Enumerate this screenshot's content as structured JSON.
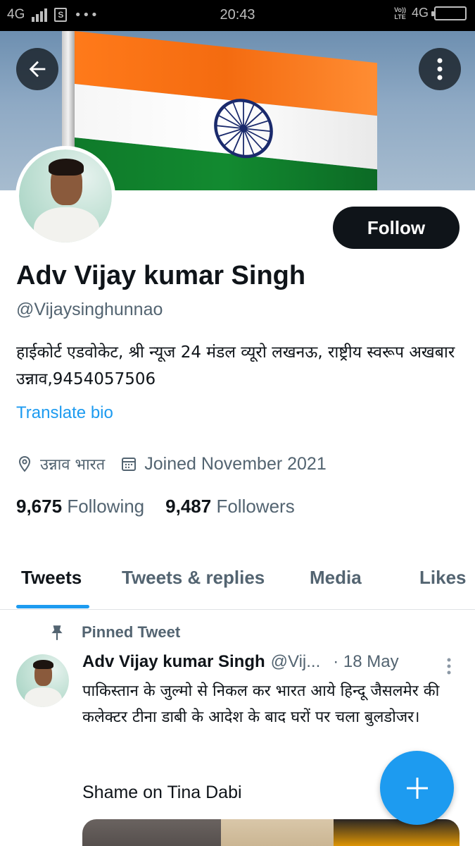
{
  "status_bar": {
    "left_network": "4G",
    "time": "20:43",
    "volte_top": "Vo))",
    "volte_bottom": "LTE",
    "right_network": "4G"
  },
  "profile": {
    "display_name": "Adv Vijay kumar Singh",
    "handle": "@Vijaysinghunnao",
    "bio": "हाईकोर्ट एडवोकेट, श्री न्यूज 24 मंडल व्यूरो लखनऊ, राष्ट्रीय स्वरूप अखबार उन्नाव,9454057506",
    "translate_label": "Translate bio",
    "location": "उन्नाव भारत",
    "joined": "Joined November 2021",
    "following_count": "9,675",
    "following_label": "Following",
    "followers_count": "9,487",
    "followers_label": "Followers",
    "follow_label": "Follow"
  },
  "tabs": [
    {
      "label": "Tweets",
      "active": true
    },
    {
      "label": "Tweets & replies",
      "active": false
    },
    {
      "label": "Media",
      "active": false
    },
    {
      "label": "Likes",
      "active": false
    }
  ],
  "pinned_tweet": {
    "pin_label": "Pinned Tweet",
    "author_name": "Adv Vijay kumar Singh",
    "author_handle": "@Vij...",
    "date": "· 18 May",
    "text": "पाकिस्तान के जुल्मो से निकल कर भारत आये हिन्दू जैसलमेर की कलेक्टर टीना डाबी के आदेश के बाद घरों पर चला बुलडोजर।",
    "text2": "Shame on Tina Dabi"
  },
  "colors": {
    "accent": "#1d9bf0",
    "text_primary": "#0f1419",
    "text_secondary": "#536471",
    "follow_bg": "#0f1419"
  },
  "icons": {
    "back": "arrow-left-icon",
    "more": "more-vertical-icon",
    "location": "location-pin-icon",
    "calendar": "calendar-icon",
    "pin": "pin-icon",
    "compose": "plus-icon"
  }
}
